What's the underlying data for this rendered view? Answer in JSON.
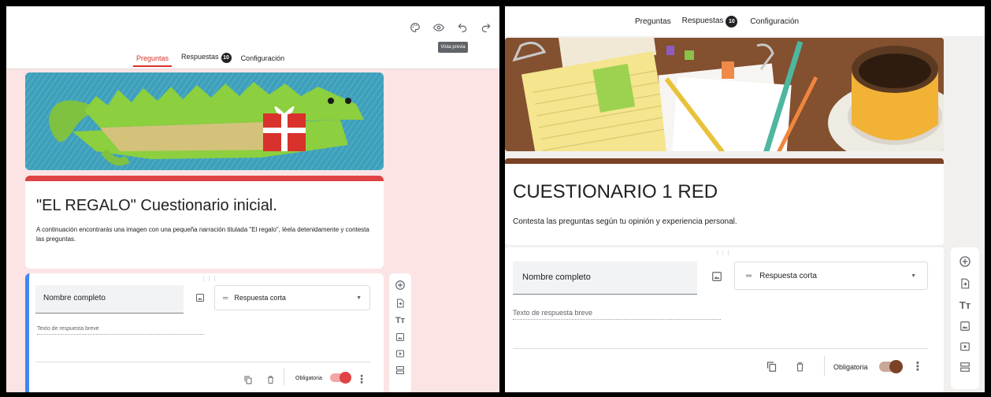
{
  "left": {
    "toolbar": {
      "icons": [
        "palette-icon",
        "eye-icon",
        "undo-icon",
        "redo-icon"
      ],
      "tooltip": "Vista previa"
    },
    "tabs": [
      {
        "label": "Preguntas"
      },
      {
        "label": "Respuestas"
      },
      {
        "label": "Configuración"
      }
    ],
    "responses_count": "10",
    "form": {
      "title": "\"EL REGALO\" Cuestionario inicial.",
      "description": "A continuación encontrarás una imagen con una pequeña narración titulada \"El regalo\", léela detenidamente y contesta las preguntas."
    },
    "question": {
      "title": "Nombre completo",
      "type": "Respuesta corta",
      "answer_placeholder": "Texto de respuesta breve",
      "required_label": "Obligatoria"
    },
    "accent_color": "#e04343"
  },
  "right": {
    "tabs": [
      {
        "label": "Preguntas"
      },
      {
        "label": "Respuestas"
      },
      {
        "label": "Configuración"
      }
    ],
    "responses_count": "10",
    "form": {
      "title": "CUESTIONARIO 1 RED",
      "description": "Contesta las preguntas según tu opinión y experiencia personal."
    },
    "question": {
      "title": "Nombre completo",
      "type": "Respuesta corta",
      "answer_placeholder": "Texto de respuesta breve",
      "required_label": "Obligatoria"
    },
    "accent_color": "#7b4226"
  }
}
